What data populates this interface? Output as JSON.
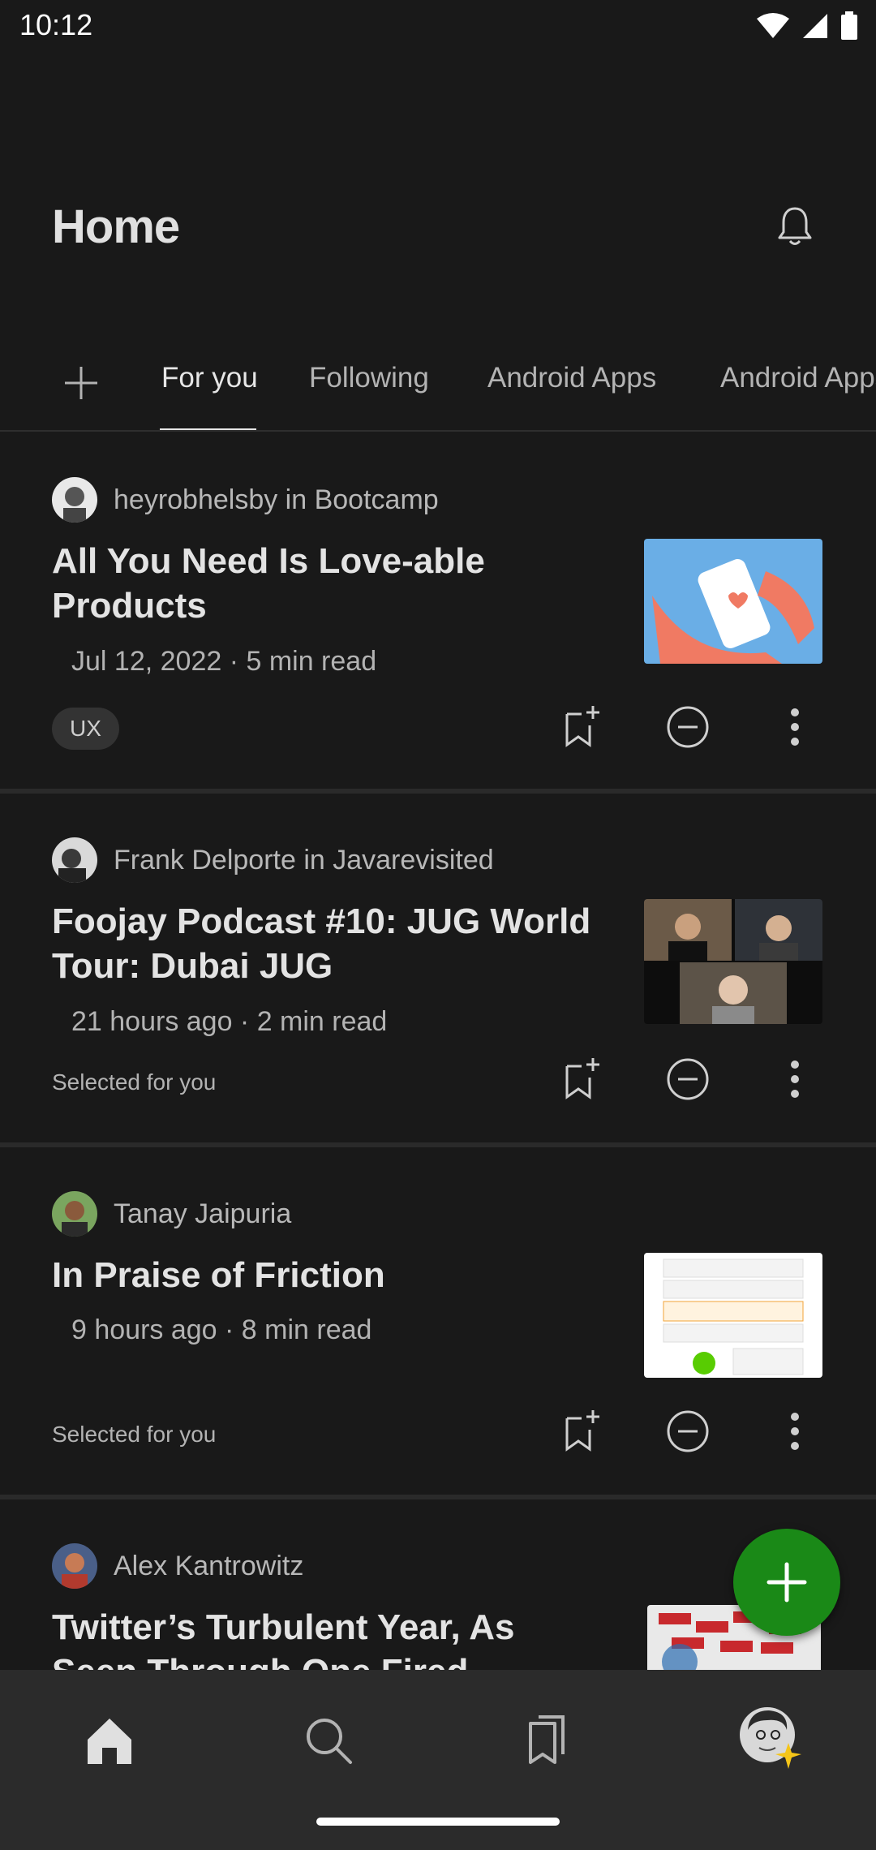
{
  "status_bar": {
    "time": "10:12"
  },
  "header": {
    "title": "Home"
  },
  "tabs": [
    {
      "label": "For you",
      "active": true
    },
    {
      "label": "Following",
      "active": false
    },
    {
      "label": "Android Apps",
      "active": false
    },
    {
      "label": "Android Apps",
      "active": false
    }
  ],
  "articles": [
    {
      "author_line": "heyrobhelsby in Bootcamp",
      "title": "All You Need Is Love-able Products",
      "meta": "Jul 12, 2022 · 5 min read",
      "tag": "UX",
      "note": ""
    },
    {
      "author_line": "Frank Delporte in Javarevisited",
      "title": "Foojay Podcast #10: JUG World Tour: Dubai JUG",
      "meta": "21 hours ago · 2 min read",
      "tag": "",
      "note": "Selected for you"
    },
    {
      "author_line": "Tanay Jaipuria",
      "title": "In Praise of Friction",
      "meta": "9 hours ago · 8 min read",
      "tag": "",
      "note": "Selected for you"
    },
    {
      "author_line": "Alex Kantrowitz",
      "title": "Twitter’s Turbulent Year, As Seen Through One Fired Employee’s",
      "meta": "",
      "tag": "",
      "note": ""
    }
  ],
  "colors": {
    "background": "#191919",
    "accent_green": "#1a8917",
    "star": "#f5c518"
  },
  "icons": [
    "wifi-icon",
    "signal-icon",
    "battery-icon",
    "bell-icon",
    "plus-icon",
    "bookmark-add-icon",
    "show-less-icon",
    "more-icon",
    "home-icon",
    "search-icon",
    "library-icon",
    "profile-avatar"
  ]
}
